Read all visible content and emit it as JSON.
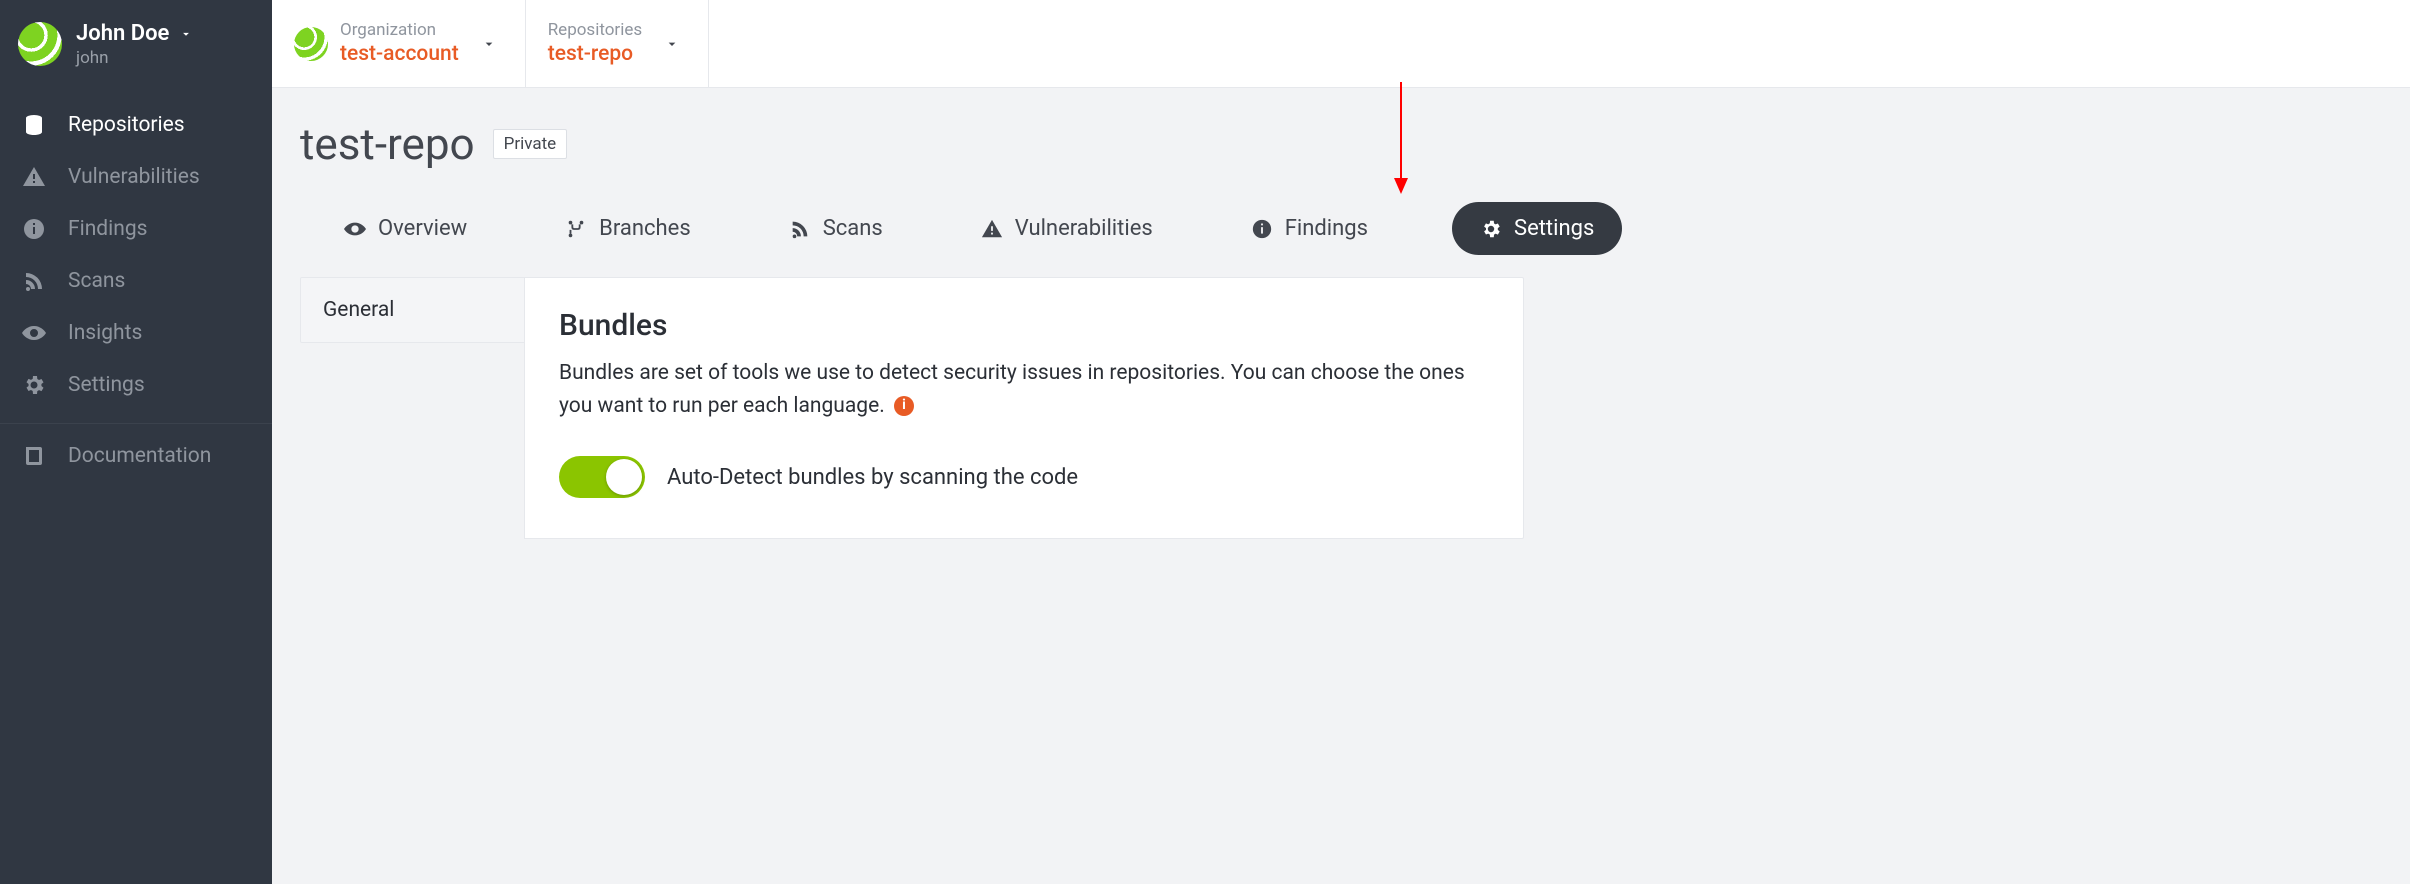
{
  "user": {
    "name": "John Doe",
    "handle": "john"
  },
  "sidebar": {
    "items": [
      {
        "label": "Repositories",
        "icon": "database",
        "active": true
      },
      {
        "label": "Vulnerabilities",
        "icon": "warning",
        "active": false
      },
      {
        "label": "Findings",
        "icon": "info",
        "active": false
      },
      {
        "label": "Scans",
        "icon": "rss",
        "active": false
      },
      {
        "label": "Insights",
        "icon": "eye",
        "active": false
      },
      {
        "label": "Settings",
        "icon": "gear",
        "active": false
      }
    ],
    "footer": [
      {
        "label": "Documentation",
        "icon": "book"
      }
    ]
  },
  "breadcrumb": {
    "org_label": "Organization",
    "org_value": "test-account",
    "repo_label": "Repositories",
    "repo_value": "test-repo"
  },
  "repo": {
    "name": "test-repo",
    "visibility": "Private"
  },
  "tabs": [
    {
      "label": "Overview",
      "icon": "eye"
    },
    {
      "label": "Branches",
      "icon": "branch"
    },
    {
      "label": "Scans",
      "icon": "rss"
    },
    {
      "label": "Vulnerabilities",
      "icon": "warning"
    },
    {
      "label": "Findings",
      "icon": "info"
    },
    {
      "label": "Settings",
      "icon": "gear",
      "active": true
    }
  ],
  "settings_side": {
    "items": [
      "General"
    ]
  },
  "bundles": {
    "title": "Bundles",
    "description": "Bundles are set of tools we use to detect security issues in repositories. You can choose the ones you want to run per each language.",
    "info_glyph": "i",
    "toggle_label": "Auto-Detect bundles by scanning the code",
    "toggle_state": true
  },
  "colors": {
    "accent": "#e85b25",
    "sidebar_bg": "#303742",
    "toggle_on": "#8bc500",
    "annotation": "#ff0000"
  }
}
